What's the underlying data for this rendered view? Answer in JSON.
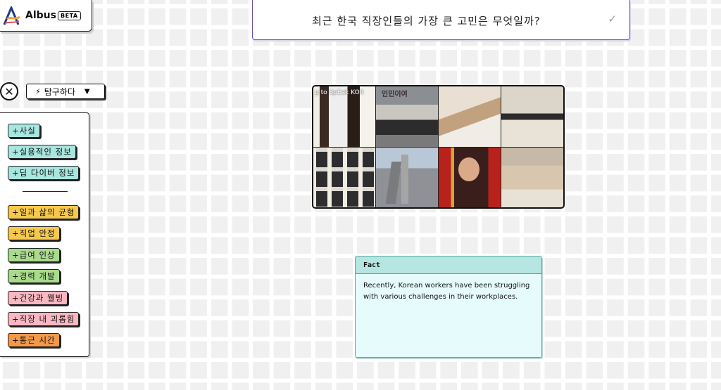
{
  "app": {
    "name": "Albus",
    "badge": "BETA"
  },
  "question": {
    "text": "최근 한국 직장인들의 가장 큰 고민은 무엇일까?"
  },
  "toolbar": {
    "close_label": "✕",
    "explore_label": "탐구하다"
  },
  "sidebar": {
    "items": [
      {
        "label": "+사실",
        "color": "#a8e6e0"
      },
      {
        "label": "+실용적인 정보",
        "color": "#a8e6e0"
      },
      {
        "label": "+딥 다이버 정보",
        "color": "#a8e6e0"
      },
      {
        "label": "+일과 삶의 균형",
        "color": "#f6c94e"
      },
      {
        "label": "+직업 안정",
        "color": "#f6c94e"
      },
      {
        "label": "+급여 인상",
        "color": "#a9db8c"
      },
      {
        "label": "+경력 개발",
        "color": "#a9db8c"
      },
      {
        "label": "+건강과 웰빙",
        "color": "#f9b7c2"
      },
      {
        "label": "+직장 내 괴롭힘",
        "color": "#f9b7c2"
      },
      {
        "label": "+통근 시간",
        "color": "#f3994a"
      }
    ]
  },
  "images": {
    "captions": [
      "g to SpEak KOR",
      "인민이여"
    ]
  },
  "fact_card": {
    "title": "Fact",
    "body": "Recently, Korean workers have been struggling with various challenges in their workplaces."
  }
}
